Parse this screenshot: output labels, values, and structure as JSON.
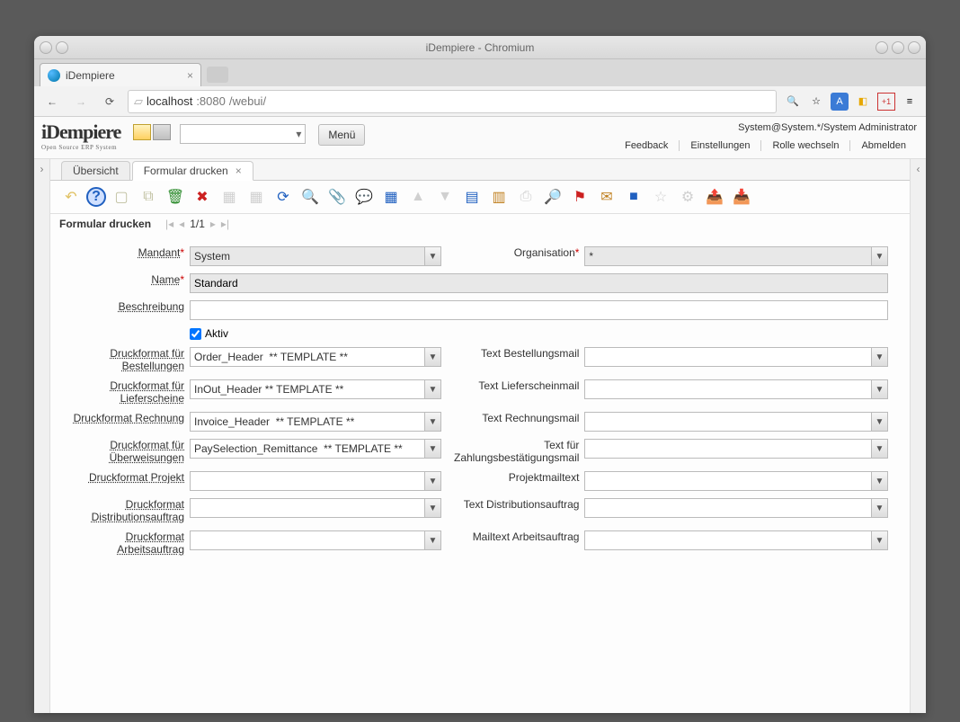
{
  "window": {
    "title": "iDempiere - Chromium"
  },
  "browser": {
    "tab_title": "iDempiere",
    "url_host": "localhost",
    "url_port": ":8080",
    "url_path": "/webui/"
  },
  "header": {
    "logo_main": "iDempiere",
    "logo_sub": "Open Source ERP System",
    "menu_button": "Menü",
    "user_info": "System@System.*/System Administrator",
    "links": {
      "feedback": "Feedback",
      "settings": "Einstellungen",
      "switch_role": "Rolle wechseln",
      "logout": "Abmelden"
    }
  },
  "tabs": {
    "overview": "Übersicht",
    "active": "Formular drucken"
  },
  "breadcrumb": {
    "title": "Formular drucken",
    "pager": "1/1"
  },
  "form": {
    "mandant": {
      "label": "Mandant",
      "value": "System"
    },
    "organisation": {
      "label": "Organisation",
      "value": "*"
    },
    "name": {
      "label": "Name",
      "value": "Standard"
    },
    "beschreibung": {
      "label": "Beschreibung",
      "value": ""
    },
    "aktiv": {
      "label": "Aktiv",
      "checked": true
    },
    "rows": [
      {
        "l1": "Druckformat für Bestellungen",
        "v1": "Order_Header  ** TEMPLATE **",
        "l2": "Text Bestellungsmail",
        "v2": ""
      },
      {
        "l1": "Druckformat für Lieferscheine",
        "v1": "InOut_Header ** TEMPLATE **",
        "l2": "Text Lieferscheinmail",
        "v2": ""
      },
      {
        "l1": "Druckformat Rechnung",
        "v1": "Invoice_Header  ** TEMPLATE **",
        "l2": "Text Rechnungsmail",
        "v2": ""
      },
      {
        "l1": "Druckformat für Überweisungen",
        "v1": "PaySelection_Remittance  ** TEMPLATE **",
        "l2": "Text für Zahlungsbestätigungsmail",
        "v2": ""
      },
      {
        "l1": "Druckformat Projekt",
        "v1": "",
        "l2": "Projektmailtext",
        "v2": ""
      },
      {
        "l1": "Druckformat Distributionsauftrag",
        "v1": "",
        "l2": "Text Distributionsauftrag",
        "v2": ""
      },
      {
        "l1": "Druckformat Arbeitsauftrag",
        "v1": "",
        "l2": "Mailtext Arbeitsauftrag",
        "v2": ""
      }
    ]
  },
  "toolbar_icons": [
    {
      "name": "undo-icon",
      "glyph": "↶",
      "color": "#e0c060"
    },
    {
      "name": "help-icon",
      "glyph": "?",
      "color": "#2060c0",
      "bg": "#d0e0ff",
      "round": true
    },
    {
      "name": "new-icon",
      "glyph": "▢",
      "color": "#c0c0a0"
    },
    {
      "name": "copy-icon",
      "glyph": "⧉",
      "color": "#c0c0a0"
    },
    {
      "name": "delete-icon",
      "glyph": "🗑",
      "color": "#2a8a2a"
    },
    {
      "name": "delete-red-icon",
      "glyph": "✖",
      "color": "#cc2020"
    },
    {
      "name": "save-icon",
      "glyph": "▦",
      "color": "#d0d0d0"
    },
    {
      "name": "saveall-icon",
      "glyph": "▦",
      "color": "#d0d0d0"
    },
    {
      "name": "refresh-icon",
      "glyph": "⟳",
      "color": "#2060c0"
    },
    {
      "name": "find-icon",
      "glyph": "🔍",
      "color": "#2060c0"
    },
    {
      "name": "attach-icon",
      "glyph": "📎",
      "color": "#888"
    },
    {
      "name": "chat-icon",
      "glyph": "💬",
      "color": "#aac0dd"
    },
    {
      "name": "grid-icon",
      "glyph": "▦",
      "color": "#2060c0"
    },
    {
      "name": "up-icon",
      "glyph": "▲",
      "color": "#d0d0d0"
    },
    {
      "name": "down-icon",
      "glyph": "▼",
      "color": "#d0d0d0"
    },
    {
      "name": "report-icon",
      "glyph": "▤",
      "color": "#2060c0"
    },
    {
      "name": "archive-icon",
      "glyph": "▥",
      "color": "#c08020"
    },
    {
      "name": "print-icon",
      "glyph": "⎙",
      "color": "#d0d0d0"
    },
    {
      "name": "zoom-icon",
      "glyph": "🔎",
      "color": "#2060c0"
    },
    {
      "name": "active-wf-icon",
      "glyph": "⚑",
      "color": "#cc2020"
    },
    {
      "name": "request-icon",
      "glyph": "✉",
      "color": "#c08020"
    },
    {
      "name": "product-icon",
      "glyph": "■",
      "color": "#2060c0"
    },
    {
      "name": "fav-icon",
      "glyph": "☆",
      "color": "#d0d0d0"
    },
    {
      "name": "process-icon",
      "glyph": "⚙",
      "color": "#d0d0d0"
    },
    {
      "name": "export-icon",
      "glyph": "📤",
      "color": "#2a8a2a"
    },
    {
      "name": "import-icon",
      "glyph": "📥",
      "color": "#c0a020"
    }
  ]
}
